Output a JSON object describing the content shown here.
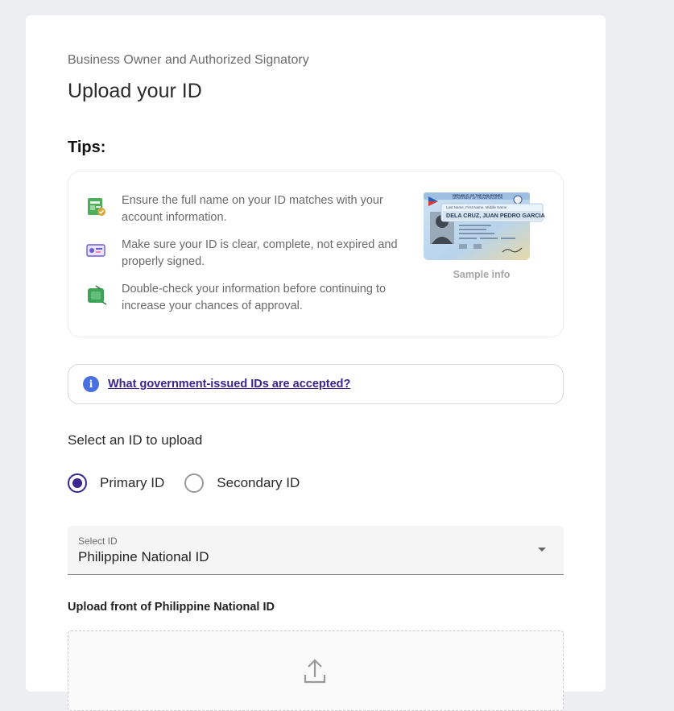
{
  "header": {
    "eyebrow": "Business Owner and Authorized Signatory",
    "title": "Upload your ID"
  },
  "tips": {
    "heading": "Tips:",
    "items": [
      {
        "icon": "id-check-icon",
        "text": "Ensure the full name on your ID matches with your account information."
      },
      {
        "icon": "id-card-icon",
        "text": "Make sure your ID is clear, complete, not expired and properly signed."
      },
      {
        "icon": "wallet-tag-icon",
        "text": "Double-check your information before continuing to increase your chances of approval."
      }
    ],
    "sample": {
      "caption": "Sample info",
      "card_header": "REPUBLIC OF THE PHILIPPINES",
      "card_subheader": "DEPARTMENT OF TRANSPORTATION",
      "name_field_label": "Last Name, First Name, Middle Name",
      "name_value": "DELA CRUZ, JUAN PEDRO GARCIA"
    }
  },
  "info": {
    "icon": "info-icon",
    "link_text": "What government-issued IDs are accepted?"
  },
  "id_selection": {
    "label": "Select an ID to upload",
    "options": [
      {
        "label": "Primary ID",
        "checked": true
      },
      {
        "label": "Secondary ID",
        "checked": false
      }
    ],
    "select": {
      "label": "Select ID",
      "value": "Philippine National ID"
    }
  },
  "upload": {
    "label": "Upload front of Philippine National ID",
    "icon": "upload-icon"
  },
  "colors": {
    "accent": "#3b2490",
    "info_blue": "#4a6fe0",
    "background": "#eceef1"
  }
}
